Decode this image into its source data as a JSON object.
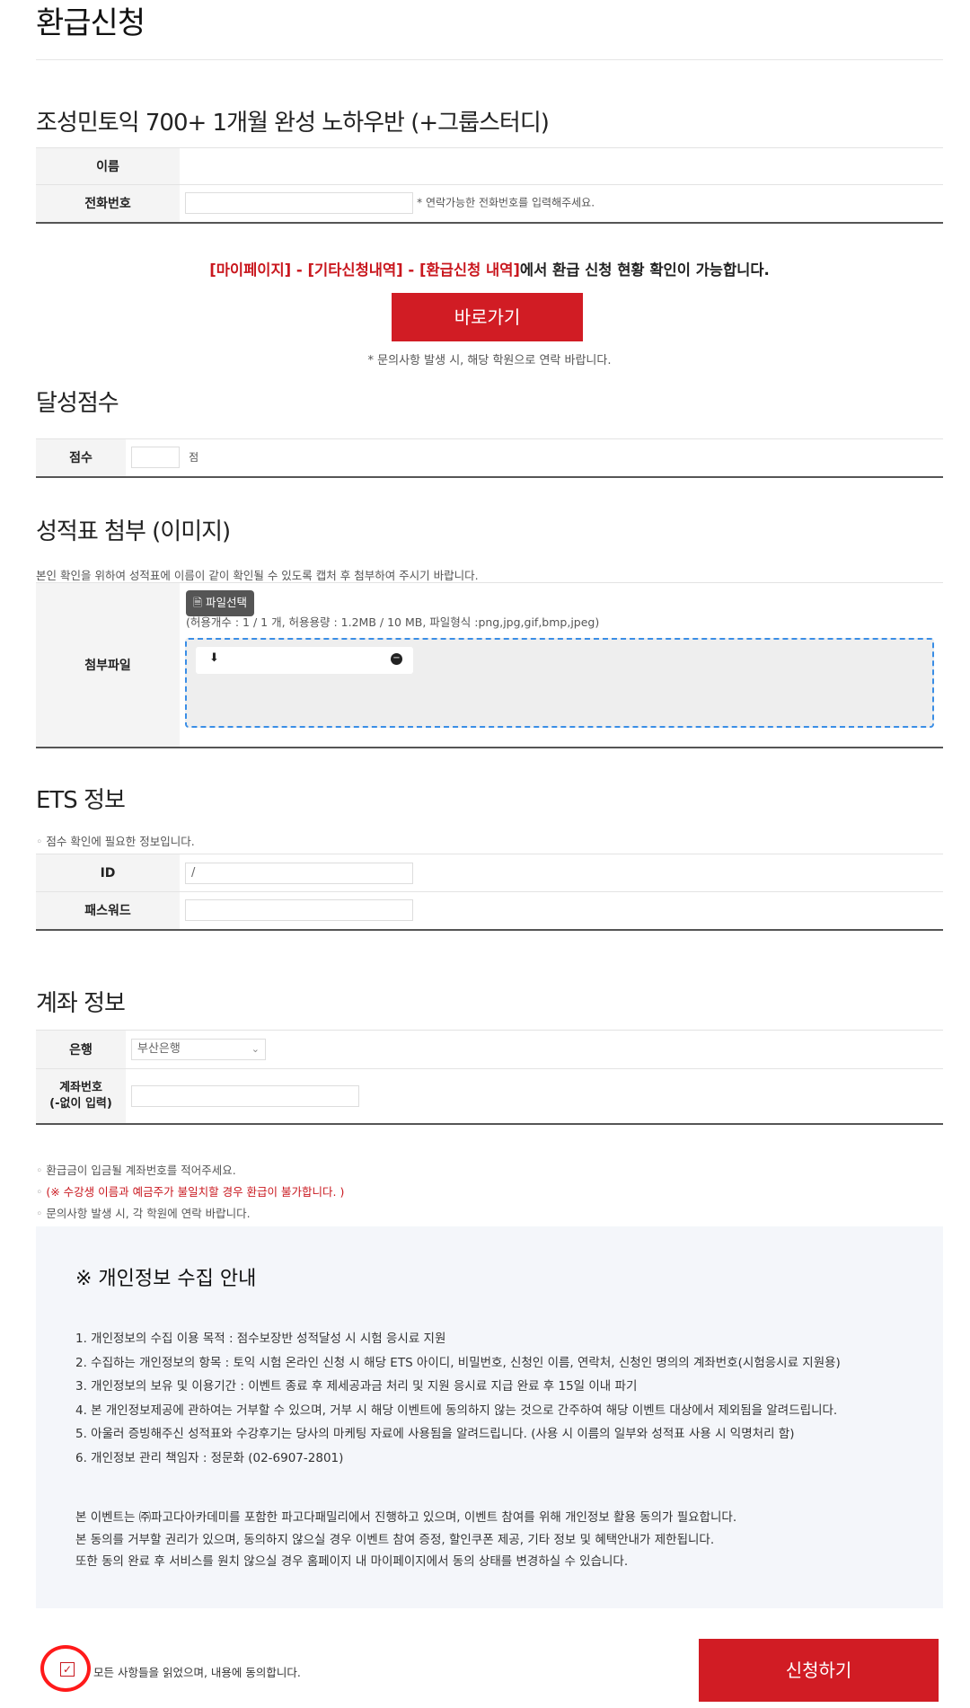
{
  "page_title": "환급신청",
  "course_title": "조성민토익 700+ 1개월 완성 노하우반 (+그룹스터디)",
  "applicant": {
    "name_label": "이름",
    "phone_label": "전화번호",
    "phone_note": "* 연락가능한 전화번호를 입력해주세요."
  },
  "notice": {
    "part1": "[마이페이지] - [기타신청내역] - [환급신청 내역]",
    "part2": "에서 환급 신청 현황 확인이 가능합니다.",
    "goto_button": "바로가기",
    "inquiry": "* 문의사항 발생 시, 해당 학원으로 연락 바랍니다."
  },
  "score": {
    "heading": "달성점수",
    "label": "점수",
    "unit": "점"
  },
  "attachment": {
    "heading": "성적표 첨부 (이미지)",
    "desc": "본인 확인을 위하여 성적표에 이름이 같이 확인될 수 있도록 캡처 후 첨부하여 주시기 바랍니다.",
    "label": "첨부파일",
    "file_button": "파일선택",
    "limits": "(허용개수 : 1 / 1 개,   허용용량 : 1.2MB / 10 MB,   파일형식 :png,jpg,gif,bmp,jpeg)"
  },
  "ets": {
    "heading": "ETS 정보",
    "desc": "점수 확인에 필요한 정보입니다.",
    "id_label": "ID",
    "id_value": "/",
    "password_label": "패스워드"
  },
  "account": {
    "heading": "계좌 정보",
    "bank_label": "은행",
    "bank_selected": "부산은행",
    "number_label_line1": "계좌번호",
    "number_label_line2": "(-없이 입력)",
    "notes": [
      "환급금이 입금될 계좌번호를 적어주세요.",
      "(※ 수강생 이름과 예금주가 불일치할 경우 환급이 불가합니다. )",
      "문의사항 발생 시, 각 학원에 연락 바랍니다."
    ]
  },
  "privacy": {
    "title": "※ 개인정보 수집 안내",
    "items": [
      "1. 개인정보의 수집 이용 목적 : 점수보장반 성적달성 시 시험 응시료 지원",
      "2. 수집하는 개인정보의 항목 : 토익 시험 온라인 신청 시 해당 ETS 아이디, 비밀번호, 신청인 이름, 연락처, 신청인 명의의 계좌번호(시험응시료 지원용)",
      "3. 개인정보의 보유 및 이용기간 : 이벤트 종료 후 제세공과금 처리 및 지원 응시료 지급 완료 후 15일 이내 파기",
      "4. 본 개인정보제공에 관하여는 거부할 수 있으며, 거부 시 해당 이벤트에 동의하지 않는 것으로 간주하여 해당 이벤트 대상에서 제외됨을 알려드립니다.",
      "5. 아울러 증빙해주신 성적표와 수강후기는 당사의 마케팅 자료에 사용됨을 알려드립니다. (사용 시 이름의 일부와 성적표 사용 시 익명처리 함)",
      "6. 개인정보 관리 책임자 : 정문화 (02-6907-2801)"
    ],
    "paragraphs": [
      "본 이벤트는 ㈜파고다아카데미를 포함한 파고다패밀리에서 진행하고 있으며, 이벤트 참여를 위해 개인정보 활용 동의가 필요합니다.",
      "본 동의를 거부할 권리가 있으며, 동의하지 않으실 경우 이벤트 참여 증정, 할인쿠폰 제공, 기타 정보 및 혜택안내가 제한됩니다.",
      "또한 동의 완료 후 서비스를 원치 않으실 경우 홈페이지 내 마이페이지에서 동의 상태를 변경하실 수 있습니다."
    ]
  },
  "agree": {
    "label": "모든 사항들을 읽었으며, 내용에 동의합니다.",
    "submit": "신청하기"
  }
}
